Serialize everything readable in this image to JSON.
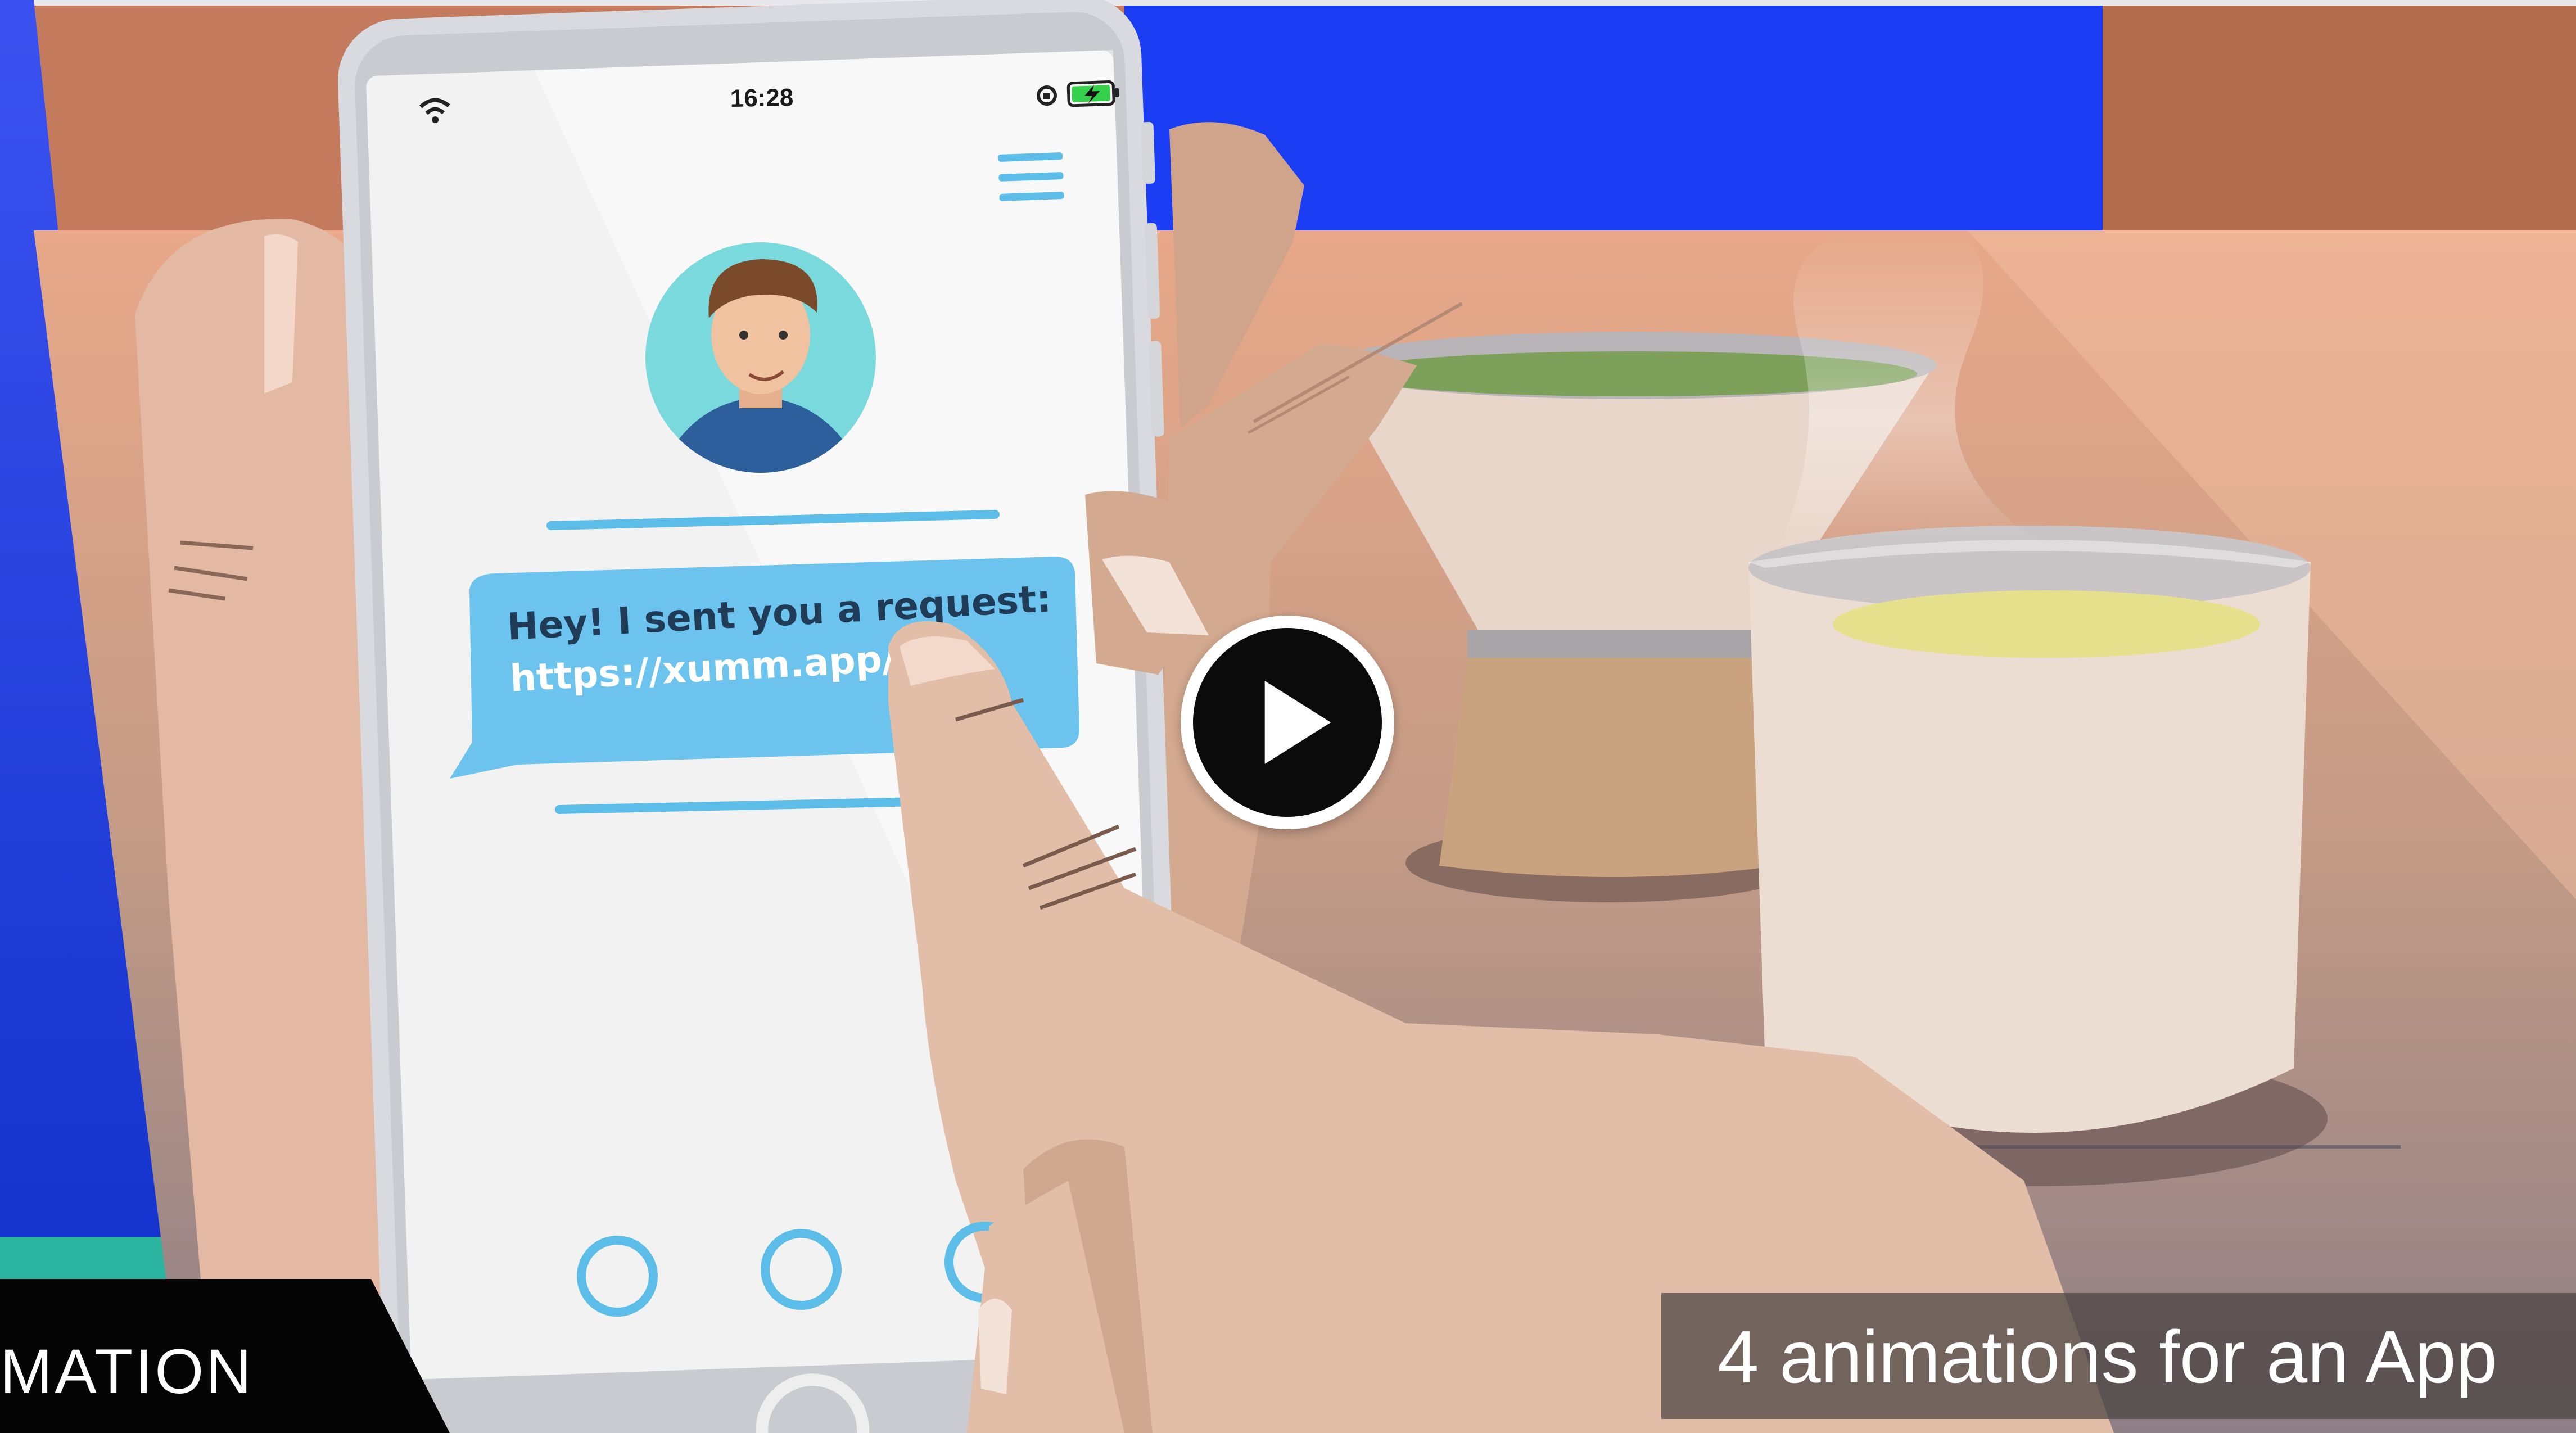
{
  "status_bar": {
    "time": "16:28",
    "wifi_icon": "wifi-icon",
    "rotation_lock_icon": "rotation-lock-icon",
    "battery_icon": "battery-charging-icon"
  },
  "app": {
    "menu_icon": "hamburger-menu-icon",
    "avatar": "user-avatar",
    "message": {
      "line1": "Hey! I sent you a request:",
      "line2": "https://xumm.app/r"
    },
    "page_indicators": 3
  },
  "video": {
    "play_icon": "play-icon",
    "caption": "4 animations for an App",
    "brand_label": "MATION"
  },
  "colors": {
    "accent_blue": "#5bbde8",
    "bubble_blue": "#6cc3ee",
    "background_blue": "#1f3be0",
    "skin": "#e3b9a3",
    "cup": "#e9d8cc"
  }
}
